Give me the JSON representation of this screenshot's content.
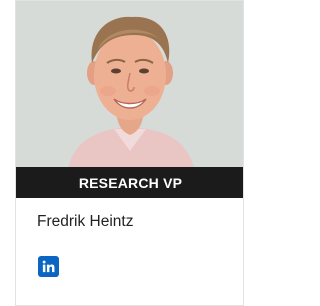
{
  "profile": {
    "role": "RESEARCH VP",
    "name": "Fredrik Heintz"
  },
  "icons": {
    "social": "linkedin-icon",
    "photo": "portrait-photo"
  },
  "colors": {
    "banner_bg": "#1b1b1b",
    "banner_text": "#ffffff",
    "linkedin": "#0a66c2",
    "photo_bg": "#d7dbd8"
  }
}
